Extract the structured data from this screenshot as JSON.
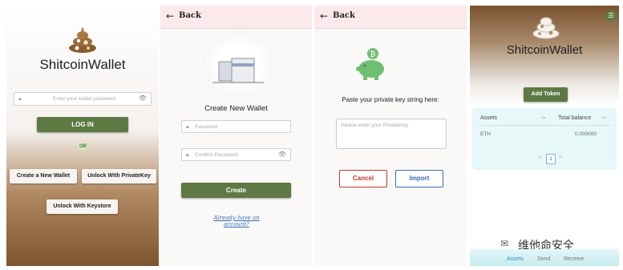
{
  "login": {
    "app_name": "ShitcoinWallet",
    "password_placeholder": "Enter your wallet password",
    "login_label": "LOG IN",
    "or_label": "OR",
    "create_label": "Create a New Wallet",
    "unlock_private_label": "Unlock With PrivateKey",
    "unlock_keystore_label": "Unlock With Keystore"
  },
  "create": {
    "back_label": "Back",
    "title": "Create New Wallet",
    "password_placeholder": "Password",
    "confirm_placeholder": "Confirm Password",
    "create_label": "Create",
    "have_account_link": "Already have an account?"
  },
  "import": {
    "back_label": "Back",
    "prompt": "Paste your private key string here:",
    "textarea_placeholder": "Please enter your PrivateKey",
    "cancel_label": "Cancel",
    "import_label": "Import"
  },
  "wallet": {
    "app_name": "ShitcoinWallet",
    "add_token_label": "Add Token",
    "table": {
      "headers": [
        "Assets",
        "Total balance"
      ],
      "rows": [
        {
          "asset": "ETH",
          "balance": "0.000000"
        }
      ]
    },
    "pagination": {
      "prev": "<",
      "current": "1",
      "next": ">"
    },
    "nav": [
      "Assets",
      "Send",
      "Receive"
    ],
    "watermark": "维他命安全"
  },
  "colors": {
    "accent_green": "#5d7a45",
    "brown": "#7d5430",
    "cancel_red": "#c0392b",
    "import_blue": "#3b6db3",
    "piggy_green": "#6fbf73"
  }
}
